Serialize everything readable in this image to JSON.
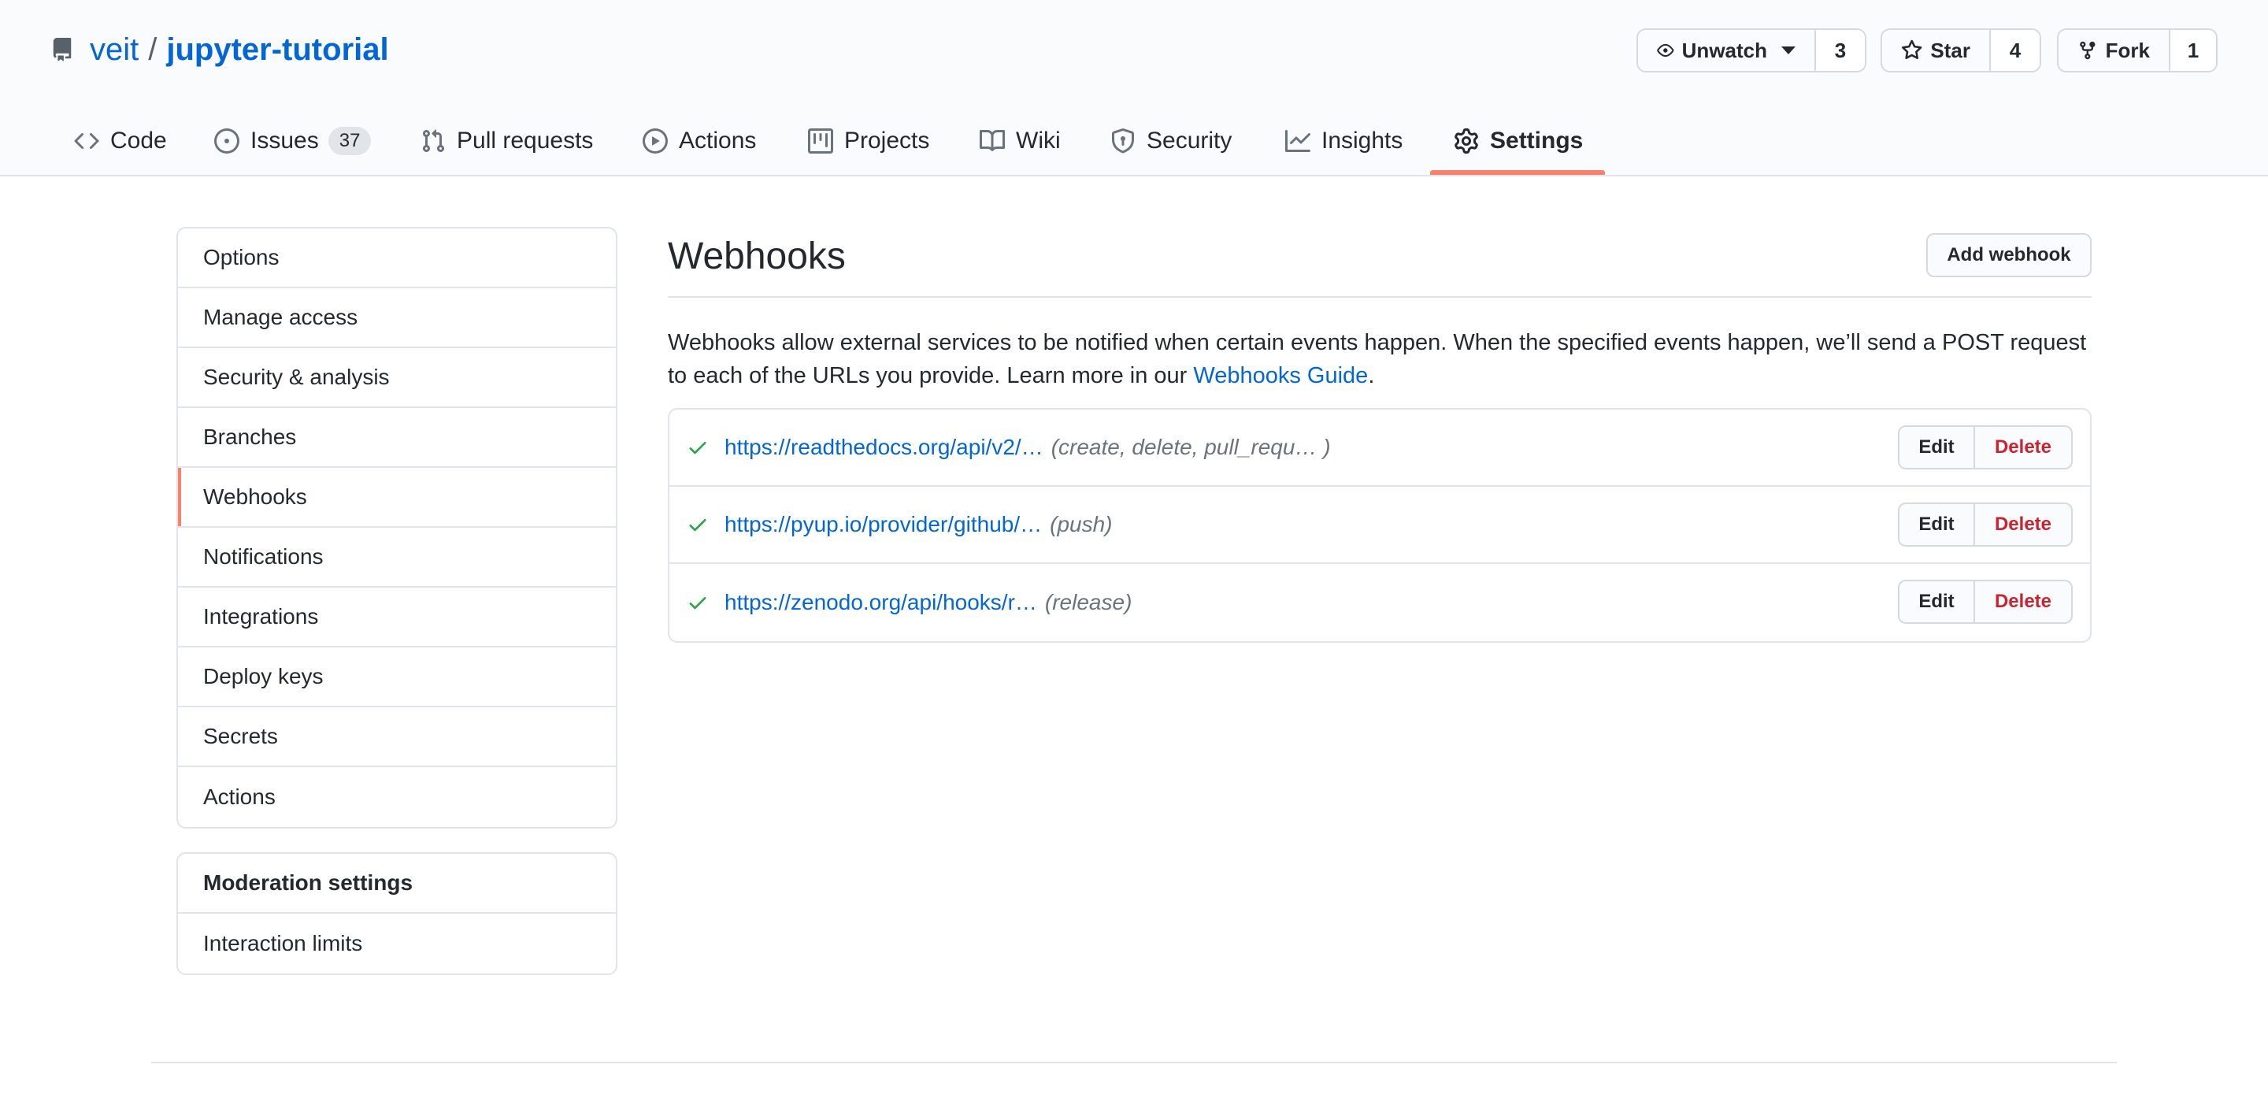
{
  "repo": {
    "owner": "veit",
    "separator": "/",
    "name": "jupyter-tutorial"
  },
  "actions": {
    "watch": {
      "label": "Unwatch",
      "count": "3"
    },
    "star": {
      "label": "Star",
      "count": "4"
    },
    "fork": {
      "label": "Fork",
      "count": "1"
    }
  },
  "tabs": [
    {
      "label": "Code",
      "icon": "code-icon"
    },
    {
      "label": "Issues",
      "icon": "issue-opened-icon",
      "count": "37"
    },
    {
      "label": "Pull requests",
      "icon": "git-pull-request-icon"
    },
    {
      "label": "Actions",
      "icon": "play-icon"
    },
    {
      "label": "Projects",
      "icon": "project-icon"
    },
    {
      "label": "Wiki",
      "icon": "book-icon"
    },
    {
      "label": "Security",
      "icon": "shield-icon"
    },
    {
      "label": "Insights",
      "icon": "graph-icon"
    },
    {
      "label": "Settings",
      "icon": "gear-icon",
      "selected": true
    }
  ],
  "sidebar": {
    "items": [
      {
        "label": "Options"
      },
      {
        "label": "Manage access"
      },
      {
        "label": "Security & analysis"
      },
      {
        "label": "Branches"
      },
      {
        "label": "Webhooks",
        "selected": true
      },
      {
        "label": "Notifications"
      },
      {
        "label": "Integrations"
      },
      {
        "label": "Deploy keys"
      },
      {
        "label": "Secrets"
      },
      {
        "label": "Actions"
      }
    ],
    "moderation": {
      "heading": "Moderation settings",
      "items": [
        {
          "label": "Interaction limits"
        }
      ]
    }
  },
  "main": {
    "title": "Webhooks",
    "add_button": "Add webhook",
    "description_before": "Webhooks allow external services to be notified when certain events happen. When the specified events happen, we’ll send a POST request to each of the URLs you provide. Learn more in our ",
    "description_link": "Webhooks Guide",
    "description_after": ".",
    "edit_label": "Edit",
    "delete_label": "Delete",
    "hooks": [
      {
        "url": "https://readthedocs.org/api/v2/…",
        "events": "(create, delete, pull_requ… )",
        "status": "check-icon"
      },
      {
        "url": "https://pyup.io/provider/github/…",
        "events": "(push)",
        "status": "check-icon"
      },
      {
        "url": "https://zenodo.org/api/hooks/r…",
        "events": "(release)",
        "status": "check-icon"
      }
    ]
  },
  "colors": {
    "link": "#0366d6",
    "success": "#28a745",
    "danger": "#cb2431",
    "selected_underline": "#f9826c"
  }
}
